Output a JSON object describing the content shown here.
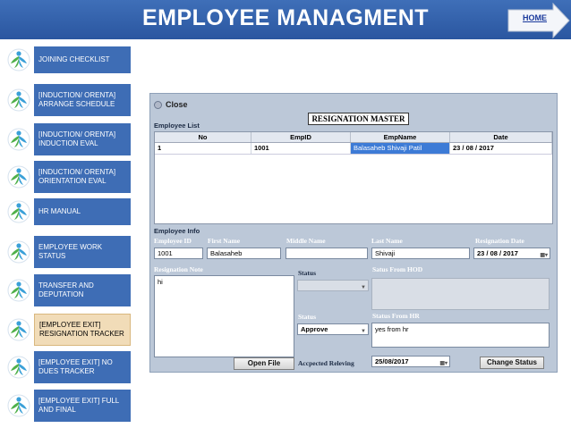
{
  "header": {
    "title": "EMPLOYEE MANAGMENT",
    "home_label": "HOME"
  },
  "sidebar": {
    "items": [
      {
        "label": "JOINING CHECKLIST",
        "active": false
      },
      {
        "label": "[INDUCTION/ ORENTA] ARRANGE SCHEDULE",
        "active": false
      },
      {
        "label": "[INDUCTION/ ORENTA] INDUCTION EVAL",
        "active": false
      },
      {
        "label": "[INDUCTION/ ORENTA] ORIENTATION EVAL",
        "active": false
      },
      {
        "label": "HR MANUAL",
        "active": false
      },
      {
        "label": "EMPLOYEE WORK STATUS",
        "active": false
      },
      {
        "label": "TRANSFER AND DEPUTATION",
        "active": false
      },
      {
        "label": "[EMPLOYEE EXIT] RESIGNATION TRACKER",
        "active": true
      },
      {
        "label": "[EMPLOYEE EXIT] NO DUES TRACKER",
        "active": false
      },
      {
        "label": "[EMPLOYEE EXIT] FULL AND FINAL",
        "active": false
      }
    ]
  },
  "window": {
    "close_label": "Close",
    "title": "RESIGNATION MASTER",
    "employee_list": {
      "label": "Employee List",
      "columns": [
        "No",
        "EmpID",
        "EmpName",
        "Date"
      ],
      "rows": [
        [
          "1",
          "1001",
          "Balasaheb  Shivaji Patil",
          "23 / 08 / 2017"
        ]
      ]
    },
    "employee_info": {
      "label": "Employee Info",
      "employee_id_label": "Employee ID",
      "employee_id": "1001",
      "first_name_label": "First Name",
      "first_name": "Balasaheb",
      "middle_name_label": "Middle Name",
      "middle_name": "",
      "last_name_label": "Last Name",
      "last_name": "Shivaji",
      "resignation_date_label": "Resignation Date",
      "resignation_date": "23 / 08 / 2017",
      "resignation_note_label": "Resignation Note",
      "resignation_note": "hi",
      "status_hod_label": "Status",
      "status_hod": "",
      "satus_from_hod_label": "Satus From HOD",
      "satus_from_hod": "",
      "status_hr_label": "Status",
      "status_hr": "Approve",
      "status_from_hr_label": "Status From HR",
      "status_from_hr": "yes from hr",
      "accepted_releving_label": "Accpected Releving",
      "accepted_releving": "25/08/2017",
      "open_file_label": "Open File",
      "change_status_label": "Change Status"
    }
  },
  "colors": {
    "banner": "#2f5ea8",
    "sidebar": "#3e6db5",
    "active_item": "#f1dcb8",
    "window_bg": "#bcc8d8",
    "selection": "#3d7bd6"
  },
  "icons": {
    "sidebar": "person-leaf-icon",
    "home": "arrow-right-icon",
    "close": "close-icon",
    "dropdown": "chevron-down-icon",
    "calendar": "calendar-icon"
  }
}
